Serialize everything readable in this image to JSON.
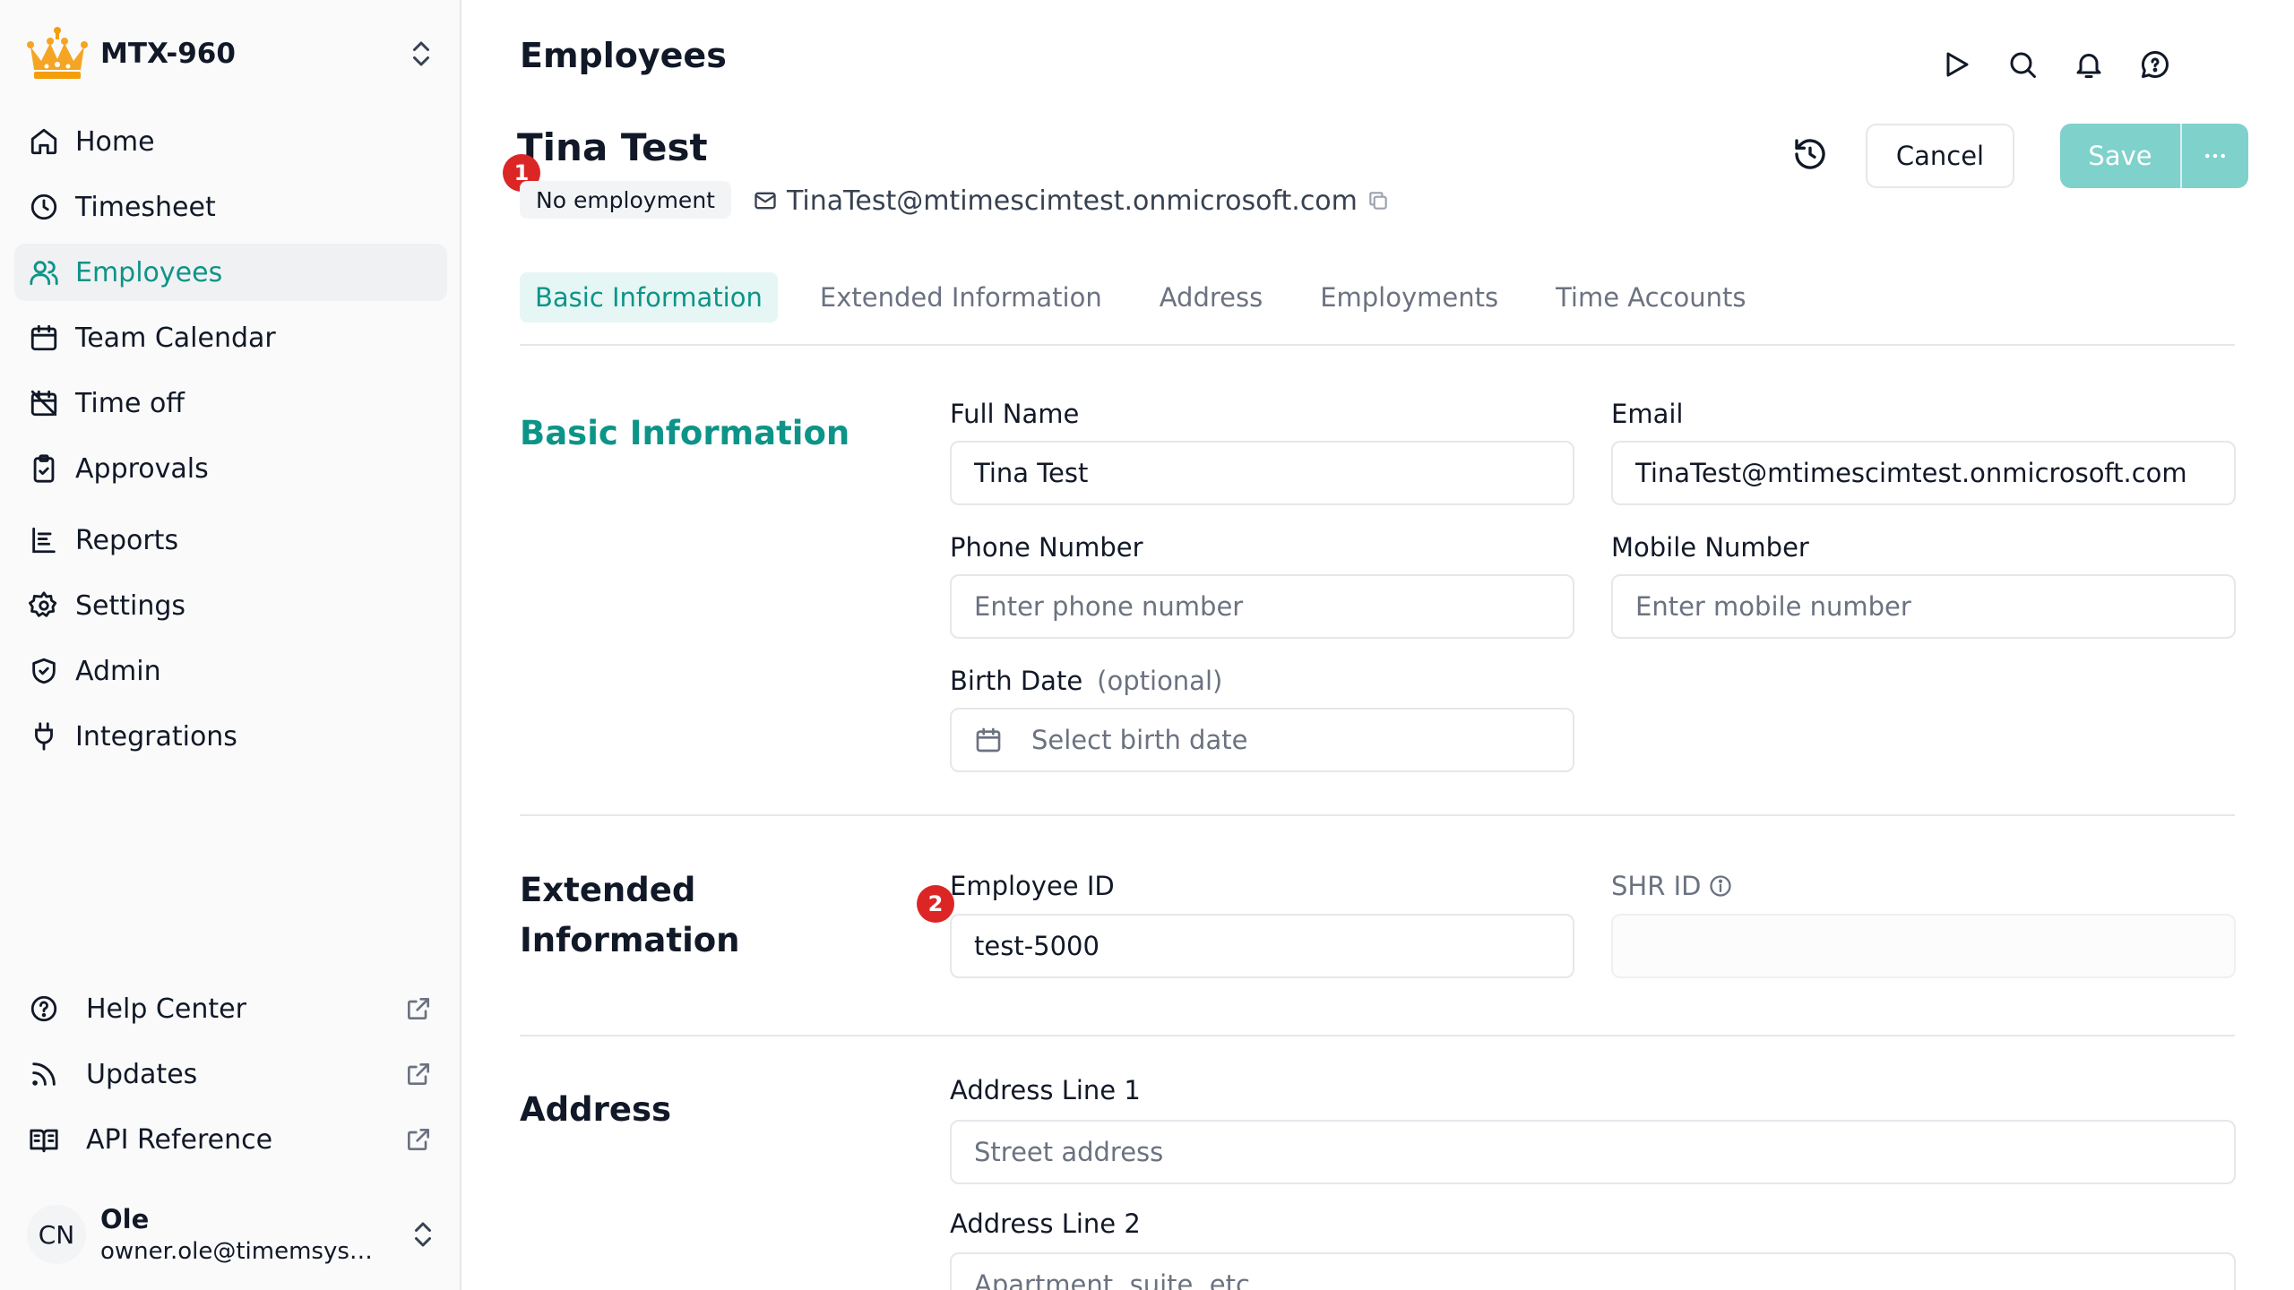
{
  "org": {
    "name": "MTX-960"
  },
  "nav": [
    {
      "label": "Home",
      "icon": "home-icon"
    },
    {
      "label": "Timesheet",
      "icon": "clock-icon"
    },
    {
      "label": "Employees",
      "icon": "users-icon",
      "active": true
    },
    {
      "label": "Team Calendar",
      "icon": "calendar-icon"
    },
    {
      "label": "Time off",
      "icon": "calendar-off-icon"
    },
    {
      "label": "Approvals",
      "icon": "clipboard-check-icon"
    },
    {
      "label": "Reports",
      "icon": "report-icon"
    },
    {
      "label": "Settings",
      "icon": "gear-icon"
    },
    {
      "label": "Admin",
      "icon": "shield-icon"
    },
    {
      "label": "Integrations",
      "icon": "plug-icon"
    }
  ],
  "bottom_nav": [
    {
      "label": "Help Center",
      "icon": "help-icon"
    },
    {
      "label": "Updates",
      "icon": "rss-icon"
    },
    {
      "label": "API Reference",
      "icon": "book-icon"
    }
  ],
  "user": {
    "initials": "CN",
    "name": "Ole",
    "email": "owner.ole@timemsystem.com"
  },
  "page": {
    "title": "Employees"
  },
  "employee": {
    "name": "Tina Test",
    "badge": "No employment",
    "email": "TinaTest@mtimescimtest.onmicrosoft.com",
    "marker_1": "1",
    "marker_2": "2"
  },
  "actions": {
    "cancel": "Cancel",
    "save": "Save"
  },
  "tabs": [
    {
      "label": "Basic Information",
      "active": true
    },
    {
      "label": "Extended Information"
    },
    {
      "label": "Address"
    },
    {
      "label": "Employments"
    },
    {
      "label": "Time Accounts"
    }
  ],
  "basic": {
    "title": "Basic Information",
    "full_name": {
      "label": "Full Name",
      "value": "Tina Test"
    },
    "email": {
      "label": "Email",
      "value": "TinaTest@mtimescimtest.onmicrosoft.com"
    },
    "phone": {
      "label": "Phone Number",
      "placeholder": "Enter phone number"
    },
    "mobile": {
      "label": "Mobile Number",
      "placeholder": "Enter mobile number"
    },
    "birth": {
      "label": "Birth Date",
      "optional": "(optional)",
      "placeholder": "Select birth date"
    }
  },
  "extended": {
    "title_line1": "Extended",
    "title_line2": "Information",
    "employee_id": {
      "label": "Employee ID",
      "value": "test-5000"
    },
    "shr_id": {
      "label": "SHR ID",
      "value": ""
    }
  },
  "address": {
    "title": "Address",
    "line1": {
      "label": "Address Line 1",
      "placeholder": "Street address"
    },
    "line2": {
      "label": "Address Line 2",
      "placeholder": "Apartment, suite, etc."
    }
  },
  "colors": {
    "accent": "#0d9488",
    "save_disabled": "#7fd1cb",
    "marker": "#dc2626"
  }
}
